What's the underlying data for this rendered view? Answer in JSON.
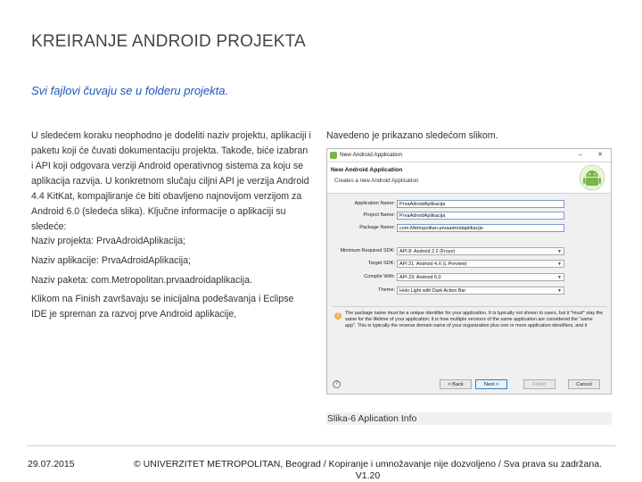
{
  "slide": {
    "title": "KREIRANJE ANDROID PROJEKTA",
    "subtitle": "Svi fajlovi čuvaju se u folderu projekta.",
    "intro": "U sledećem koraku neophodno je dodeliti naziv projektu, aplikaciji i paketu koji će čuvati dokumentaciju projekta. Takođe, biće izabran i API koji odgovara verziji Android operativnog sistema za koju se aplikacija razvija. U konkretnom slučaju ciljni API je verzija Android 4.4 KitKat, kompajliranje će biti obavljeno najnovijom verzijom za Android 6.0 (sledeća slika). Ključne informacije o aplikaciji su sledeće:",
    "naziv_projekta": "Naziv projekta: PrvaAdroidAplikacija;",
    "naziv_aplikacije": "Naziv aplikacije: PrvaAdroidAplikacija;",
    "naziv_paketa": "Naziv paketa: com.Metropolitan.prvaadroidaplikacija.",
    "finish_text": "Klikom na Finish završavaju se inicijalna podešavanja i Eclipse IDE je spreman za razvoj prve Android aplikacije,",
    "right_caption": "Navedeno je prikazano sledećom slikom.",
    "figure_caption": "Slika-6 Aplication Info",
    "footer_date": "29.07.2015",
    "footer_copy": "© UNIVERZITET METROPOLITAN, Beograd / Kopiranje i umnožavanje nije dozvoljeno / Sva prava su zadržana. V1.20"
  },
  "dialog": {
    "window_title": "New Android Application",
    "header_title": "New Android Application",
    "header_desc": "Creates a new Android Application",
    "fields": [
      {
        "label": "Application Name:",
        "value": "PrvaAdroidAplikacija"
      },
      {
        "label": "Project Name:",
        "value": "PrvaAdroidAplikacija"
      },
      {
        "label": "Package Name:",
        "value": "com.Metropolitan.prvaadroidaplikacije"
      }
    ],
    "selects": [
      {
        "label": "Minimum Required SDK:",
        "value": "API 8: Android 2.2 (Froyo)"
      },
      {
        "label": "Target SDK:",
        "value": "API 21: Android 4.X (L Preview)"
      },
      {
        "label": "Compile With:",
        "value": "API 23: Android 6.0"
      },
      {
        "label": "Theme:",
        "value": "Holo Light with Dark Action Bar"
      }
    ],
    "info": "The package name must be a unique identifier for your application. It is typically not shown to users, but it *must* stay the same for the lifetime of your application; it is how multiple versions of the same application are considered the \"same app\". This is typically the reverse domain name of your organization plus one or more application identifiers, and it",
    "buttons": {
      "back": "< Back",
      "next": "Next >",
      "finish": "Finish",
      "cancel": "Cancel"
    },
    "help_glyph": "?",
    "info_glyph": "!",
    "icons": [
      "android-icon",
      "help-icon",
      "info-icon"
    ]
  }
}
